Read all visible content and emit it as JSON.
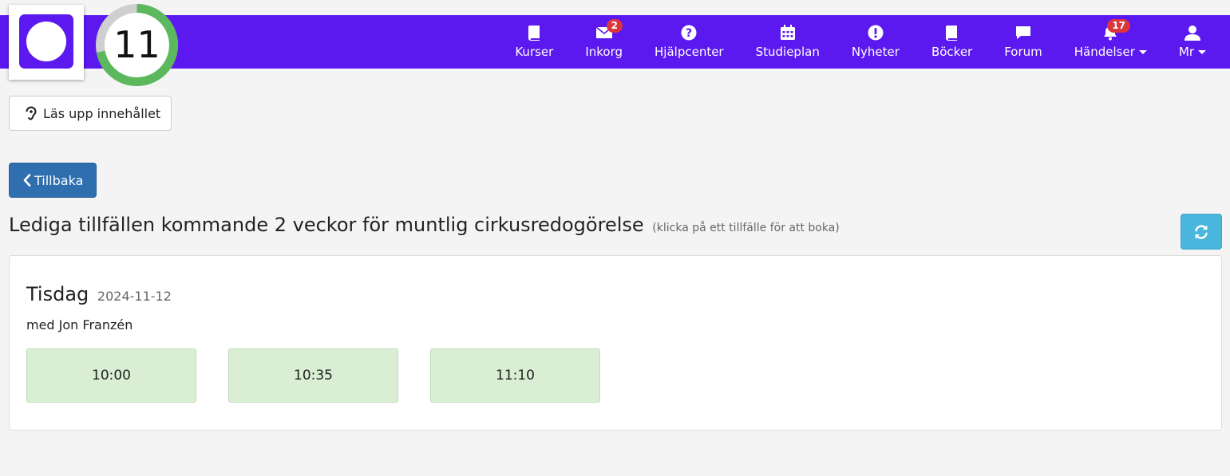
{
  "header": {
    "score": "11",
    "score_progress": 0.72,
    "nav": [
      {
        "label": "Kurser",
        "icon": "book-icon"
      },
      {
        "label": "Inkorg",
        "icon": "envelope-icon",
        "badge": "2"
      },
      {
        "label": "Hjälpcenter",
        "icon": "question-circle-icon"
      },
      {
        "label": "Studieplan",
        "icon": "calendar-icon"
      },
      {
        "label": "Nyheter",
        "icon": "exclamation-circle-icon"
      },
      {
        "label": "Böcker",
        "icon": "book-icon"
      },
      {
        "label": "Forum",
        "icon": "comment-icon"
      },
      {
        "label": "Händelser",
        "icon": "bell-icon",
        "badge": "17",
        "dropdown": true
      },
      {
        "label": "Mr",
        "icon": "user-icon",
        "dropdown": true
      }
    ]
  },
  "read_aloud_label": "Läs upp innehållet",
  "back_label": "Tillbaka",
  "heading": {
    "title": "Lediga tillfällen kommande 2 veckor för muntlig cirkusredogörelse",
    "hint": "(klicka på ett tillfälle för att boka)"
  },
  "schedule": {
    "day": "Tisdag",
    "date": "2024-11-12",
    "teacher": "med Jon Franzén",
    "slots": [
      "10:00",
      "10:35",
      "11:10"
    ]
  },
  "colors": {
    "brand": "#5b19f0",
    "back_button": "#2f6fb0",
    "refresh_button": "#4ab5dd",
    "slot_bg": "#d9eed3",
    "score_ring": "#5cb85c",
    "badge": "#d9363e"
  }
}
